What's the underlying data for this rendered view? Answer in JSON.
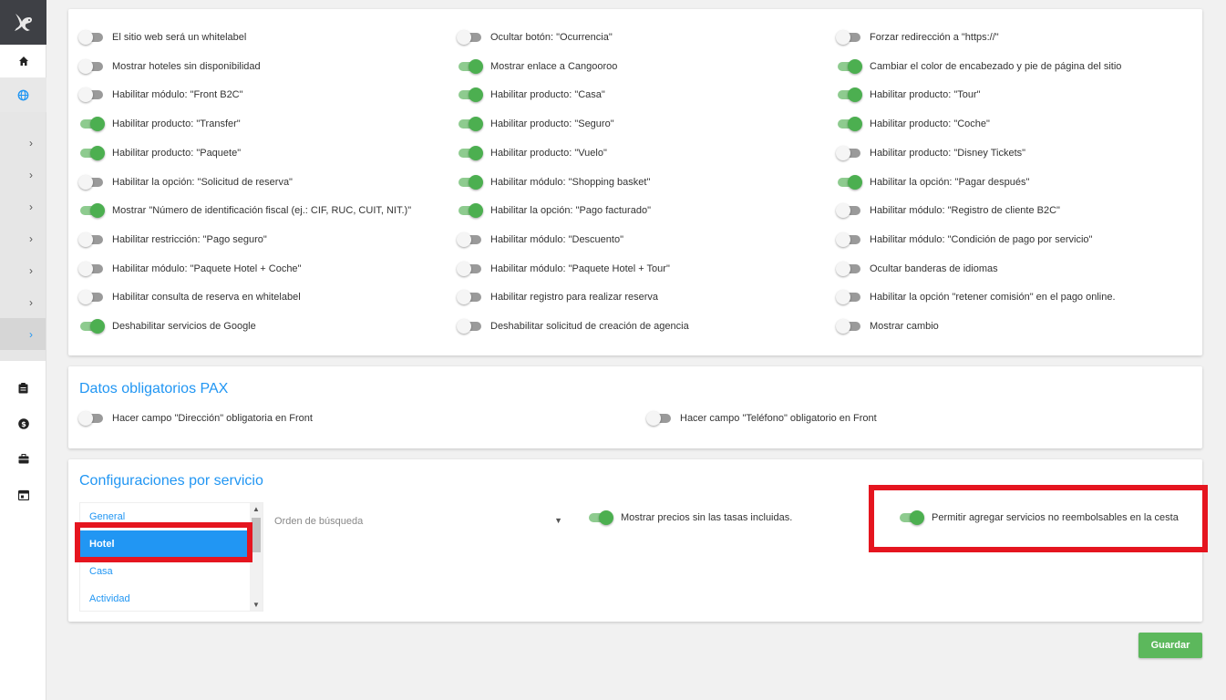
{
  "sidebar": {
    "icons": [
      "kangaroo-logo",
      "home-icon",
      "globe-icon",
      "clipboard-icon",
      "dollar-icon",
      "briefcase-icon",
      "calendar-icon"
    ],
    "sub_count": 7
  },
  "general": {
    "toggles": [
      {
        "label": "El sitio web será un whitelabel",
        "on": false
      },
      {
        "label": "Ocultar botón: \"Ocurrencia\"",
        "on": false
      },
      {
        "label": "Forzar redirección a \"https://\"",
        "on": false
      },
      {
        "label": "Mostrar hoteles sin disponibilidad",
        "on": false
      },
      {
        "label": "Mostrar enlace a Cangooroo",
        "on": true
      },
      {
        "label": "Cambiar el color de encabezado y pie de página del sitio",
        "on": true
      },
      {
        "label": "Habilitar módulo: \"Front B2C\"",
        "on": false
      },
      {
        "label": "Habilitar producto: \"Casa\"",
        "on": true
      },
      {
        "label": "Habilitar producto: \"Tour\"",
        "on": true
      },
      {
        "label": "Habilitar producto: \"Transfer\"",
        "on": true
      },
      {
        "label": "Habilitar producto: \"Seguro\"",
        "on": true
      },
      {
        "label": "Habilitar producto: \"Coche\"",
        "on": true
      },
      {
        "label": "Habilitar producto: \"Paquete\"",
        "on": true
      },
      {
        "label": "Habilitar producto: \"Vuelo\"",
        "on": true
      },
      {
        "label": "Habilitar producto: \"Disney Tickets\"",
        "on": false
      },
      {
        "label": "Habilitar la opción: \"Solicitud de reserva\"",
        "on": false
      },
      {
        "label": "Habilitar módulo: \"Shopping basket\"",
        "on": true
      },
      {
        "label": "Habilitar la opción: \"Pagar después\"",
        "on": true
      },
      {
        "label": "Mostrar \"Número de identificación fiscal (ej.: CIF, RUC, CUIT, NIT.)\"",
        "on": true
      },
      {
        "label": "Habilitar la opción: \"Pago facturado\"",
        "on": true
      },
      {
        "label": "Habilitar módulo: \"Registro de cliente B2C\"",
        "on": false
      },
      {
        "label": "Habilitar restricción: \"Pago seguro\"",
        "on": false
      },
      {
        "label": "Habilitar módulo: \"Descuento\"",
        "on": false
      },
      {
        "label": "Habilitar módulo: \"Condición de pago por servicio\"",
        "on": false
      },
      {
        "label": "Habilitar módulo: \"Paquete Hotel + Coche\"",
        "on": false
      },
      {
        "label": "Habilitar módulo: \"Paquete Hotel + Tour\"",
        "on": false
      },
      {
        "label": "Ocultar banderas de idiomas",
        "on": false
      },
      {
        "label": "Habilitar consulta de reserva en whitelabel",
        "on": false
      },
      {
        "label": "Habilitar registro para realizar reserva",
        "on": false
      },
      {
        "label": "Habilitar la opción \"retener comisión\" en el pago online.",
        "on": false
      },
      {
        "label": "Deshabilitar servicios de Google",
        "on": true
      },
      {
        "label": "Deshabilitar solicitud de creación de agencia",
        "on": false
      },
      {
        "label": "Mostrar cambio",
        "on": false
      }
    ]
  },
  "pax": {
    "title": "Datos obligatorios PAX",
    "toggles": [
      {
        "label": "Hacer campo \"Dirección\" obligatoria en Front",
        "on": false
      },
      {
        "label": "Hacer campo \"Teléfono\" obligatorio en Front",
        "on": false
      }
    ]
  },
  "services": {
    "title": "Configuraciones por servicio",
    "items": [
      "General",
      "Hotel",
      "Casa",
      "Actividad"
    ],
    "selected": "Hotel",
    "sort_placeholder": "Orden de búsqueda",
    "show_prices_label": "Mostrar precios sin las tasas incluidas.",
    "show_prices_on": true,
    "allow_nonrefundable_label": "Permitir agregar servicios no reembolsables en la cesta",
    "allow_nonrefundable_on": true
  },
  "save_label": "Guardar",
  "colors": {
    "accent": "#2196f3",
    "toggle_on": "#4caf50",
    "save": "#5cb85c",
    "highlight": "#e5151f"
  }
}
